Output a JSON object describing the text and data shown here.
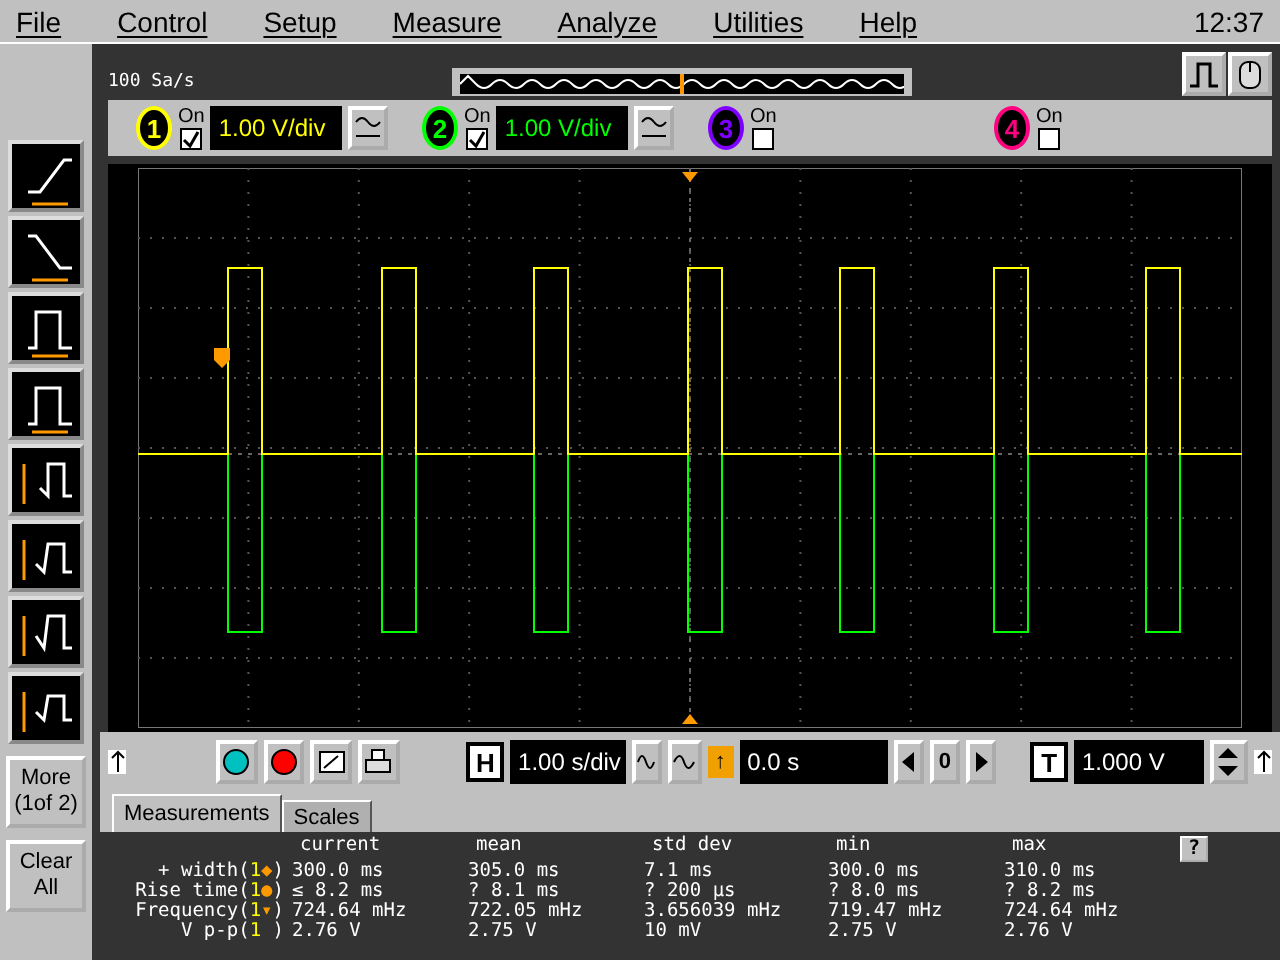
{
  "menu": [
    "File",
    "Control",
    "Setup",
    "Measure",
    "Analyze",
    "Utilities",
    "Help"
  ],
  "clock": "12:37",
  "sample_rate": "100 Sa/s",
  "channels": [
    {
      "number": "1",
      "on_label": "On",
      "on": true,
      "scale": "1.00 V/div",
      "color": "#ffff00"
    },
    {
      "number": "2",
      "on_label": "On",
      "on": true,
      "scale": "1.00 V/div",
      "color": "#00ff00"
    },
    {
      "number": "3",
      "on_label": "On",
      "on": false,
      "color": "#8000ff"
    },
    {
      "number": "4",
      "on_label": "On",
      "on": false,
      "color": "#ff0080"
    }
  ],
  "side_buttons": [
    "More\n(1of 2)",
    "Clear\nAll"
  ],
  "horizontal": {
    "label": "H",
    "scale": "1.00 s/div",
    "delay_marker": "↑",
    "delay": "0.0 s",
    "zero": "0"
  },
  "trigger": {
    "label": "T",
    "level": "1.000 V"
  },
  "tabs": [
    {
      "label": "Measurements",
      "selected": true
    },
    {
      "label": "Scales",
      "selected": false
    }
  ],
  "help": "?",
  "measurements": {
    "columns": [
      "current",
      "mean",
      "std dev",
      "min",
      "max"
    ],
    "rows": [
      {
        "name": "+ width(",
        "channel": "1",
        "marker": "◆",
        "close": ")",
        "values": [
          "300.0 ms",
          "305.0 ms",
          "7.1 ms",
          "300.0 ms",
          "310.0 ms"
        ]
      },
      {
        "name": "Rise time(",
        "channel": "1",
        "marker": "●",
        "close": ")",
        "values": [
          "≤ 8.2 ms",
          "? 8.1 ms",
          "? 200 µs",
          "? 8.0 ms",
          "? 8.2 ms"
        ]
      },
      {
        "name": "Frequency(",
        "channel": "1",
        "marker": "▾",
        "close": ")",
        "values": [
          "724.64 mHz",
          "722.05 mHz",
          "3.656039 mHz",
          "719.47 mHz",
          "724.64 mHz"
        ]
      },
      {
        "name": "V p-p(",
        "channel": "1",
        "marker": "",
        "close": ")",
        "values": [
          "2.76 V",
          "2.75 V",
          "10 mV",
          "2.75 V",
          "2.76 V"
        ]
      }
    ]
  }
}
